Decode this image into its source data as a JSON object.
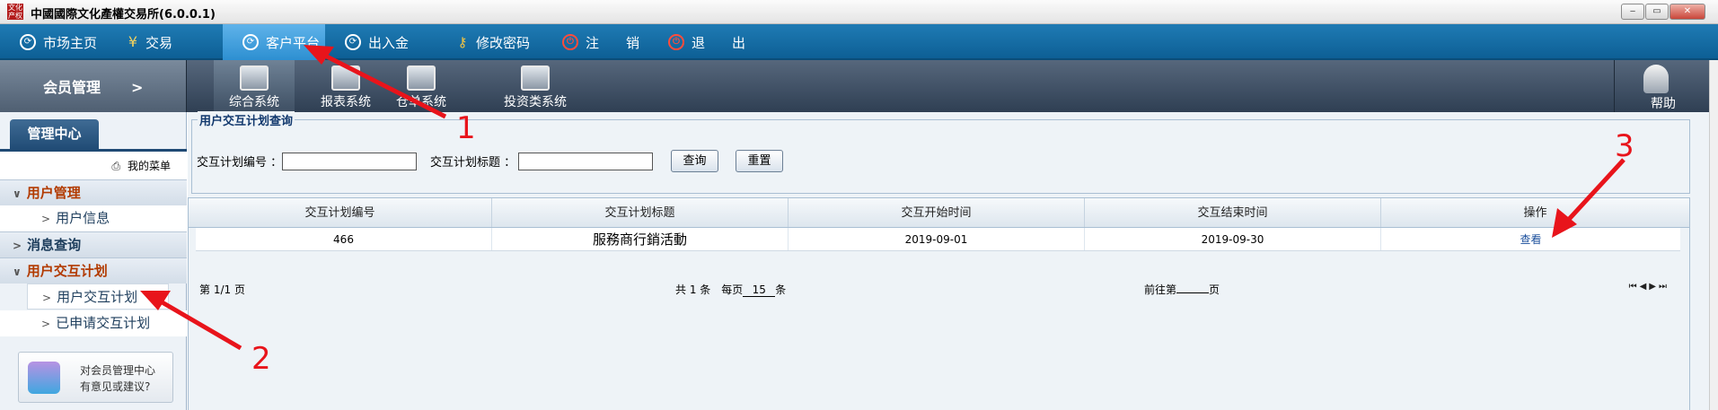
{
  "window": {
    "title": "中國國際文化產權交易所(6.0.0.1)",
    "logo_text": "文化产权",
    "buttons": [
      "‒",
      "▭",
      "✕"
    ]
  },
  "topnav": {
    "items": [
      {
        "label": "市场主页",
        "icon": "refresh-icon"
      },
      {
        "label": "交易",
        "icon": "yen-icon"
      },
      {
        "label": "客户平台",
        "icon": "refresh-icon",
        "active": true
      },
      {
        "label": "出入金",
        "icon": "refresh-icon"
      },
      {
        "label": "修改密码",
        "icon": "key-icon"
      },
      {
        "label": "注　　销",
        "icon": "power-icon"
      },
      {
        "label": "退　　出",
        "icon": "power-icon"
      }
    ]
  },
  "subbar": {
    "section": "会员管理",
    "section_arrow": ">",
    "modules": [
      "综合系统",
      "报表系统",
      "仓单系统",
      "投资类系统"
    ],
    "help": "帮助"
  },
  "sidebar": {
    "tab": "管理中心",
    "my_menu": "我的菜单",
    "groups": [
      {
        "label": "用户管理",
        "expanded": true,
        "items": [
          "用户信息"
        ]
      },
      {
        "label": "消息查询",
        "expanded": false,
        "items": []
      },
      {
        "label": "用户交互计划",
        "expanded": true,
        "items": [
          "用户交互计划",
          "已申请交互计划"
        ]
      }
    ],
    "feedback": {
      "line1": "对会员管理中心",
      "line2": "有意见或建议?"
    }
  },
  "query": {
    "legend": "用户交互计划查询",
    "field1_label": "交互计划编号 ：",
    "field1_value": "",
    "field2_label": "交互计划标题 ：",
    "field2_value": "",
    "search": "查询",
    "reset": "重置"
  },
  "table": {
    "columns": [
      "交互计划编号",
      "交互计划标题",
      "交互开始时间",
      "交互结束时间",
      "操作"
    ],
    "rows": [
      {
        "id": "466",
        "title": "服務商行銷活動",
        "start": "2019-09-01",
        "end": "2019-09-30",
        "action": "查看"
      }
    ]
  },
  "pager": {
    "page": "第 1/1 页",
    "total_prefix": "共 1 条　每页",
    "per_page": "15",
    "total_suffix": "条",
    "goto_prefix": "前往第",
    "goto_suffix": "页",
    "nav": "⏮◀▶⏭"
  },
  "annotations": {
    "one": "1",
    "two": "2",
    "three": "3",
    "color": "#e8141b"
  }
}
